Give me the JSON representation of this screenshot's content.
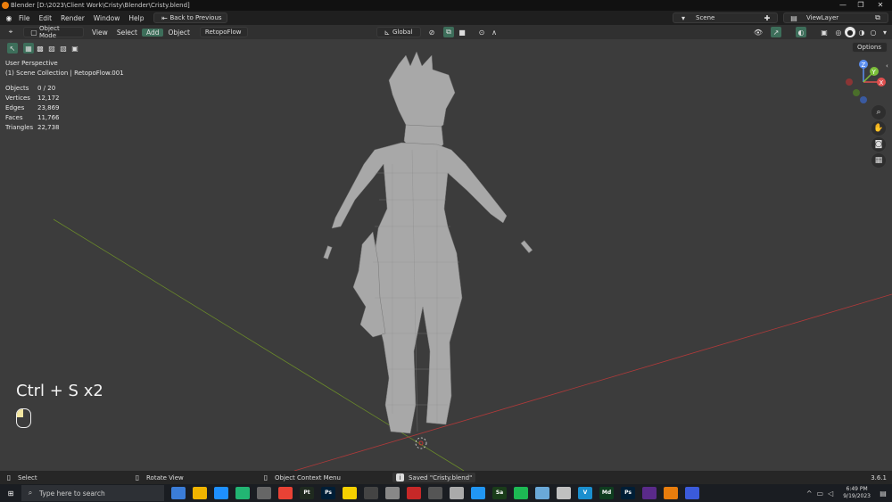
{
  "window": {
    "title": "Blender [D:\\2023\\Client Work\\Cristy\\Blender\\Cristy.blend]"
  },
  "menubar": {
    "items": [
      "File",
      "Edit",
      "Render",
      "Window",
      "Help"
    ],
    "back_label": "Back to Previous",
    "scene_label": "Scene",
    "viewlayer_label": "ViewLayer"
  },
  "header": {
    "mode": "Object Mode",
    "menus": [
      "View",
      "Select",
      "Add",
      "Object"
    ],
    "addon": "RetopoFlow",
    "orientation": "Global",
    "options": "Options"
  },
  "overlay": {
    "perspective": "User Perspective",
    "collection": "(1) Scene Collection | RetopoFlow.001",
    "stats": [
      {
        "label": "Objects",
        "value": "0 / 20"
      },
      {
        "label": "Vertices",
        "value": "12,172"
      },
      {
        "label": "Edges",
        "value": "23,869"
      },
      {
        "label": "Faces",
        "value": "11,766"
      },
      {
        "label": "Triangles",
        "value": "22,738"
      }
    ],
    "keystroke": "Ctrl + S x2"
  },
  "gizmo": {
    "z": "Z",
    "y": "Y",
    "x": "X"
  },
  "statusbar": {
    "select": "Select",
    "rotate": "Rotate View",
    "context": "Object Context Menu",
    "saved": "Saved \"Cristy.blend\"",
    "version": "3.6.1"
  },
  "taskbar": {
    "search_placeholder": "Type here to search",
    "time": "6:49 PM",
    "date": "9/19/2023",
    "apps": [
      {
        "label": "",
        "color": "#3b7dd8"
      },
      {
        "label": "",
        "color": "#f0b400"
      },
      {
        "label": "",
        "color": "#1e90ff"
      },
      {
        "label": "",
        "color": "#22b573"
      },
      {
        "label": "",
        "color": "#666"
      },
      {
        "label": "",
        "color": "#e94235"
      },
      {
        "label": "Pt",
        "color": "#1f2a1f"
      },
      {
        "label": "Ps",
        "color": "#001e36"
      },
      {
        "label": "",
        "color": "#f5d000"
      },
      {
        "label": "",
        "color": "#444"
      },
      {
        "label": "",
        "color": "#888"
      },
      {
        "label": "",
        "color": "#c62828"
      },
      {
        "label": "",
        "color": "#555"
      },
      {
        "label": "",
        "color": "#aaa"
      },
      {
        "label": "",
        "color": "#2196f3"
      },
      {
        "label": "Sa",
        "color": "#1a3d1a"
      },
      {
        "label": "",
        "color": "#1db954"
      },
      {
        "label": "",
        "color": "#6aa9d8"
      },
      {
        "label": "",
        "color": "#c0c0c0"
      },
      {
        "label": "V",
        "color": "#1a8fcf"
      },
      {
        "label": "Md",
        "color": "#0f3d1f"
      },
      {
        "label": "Ps",
        "color": "#001e36"
      },
      {
        "label": "",
        "color": "#5a2a8a"
      },
      {
        "label": "",
        "color": "#e87d0d"
      },
      {
        "label": "",
        "color": "#3b5bdb"
      }
    ]
  }
}
